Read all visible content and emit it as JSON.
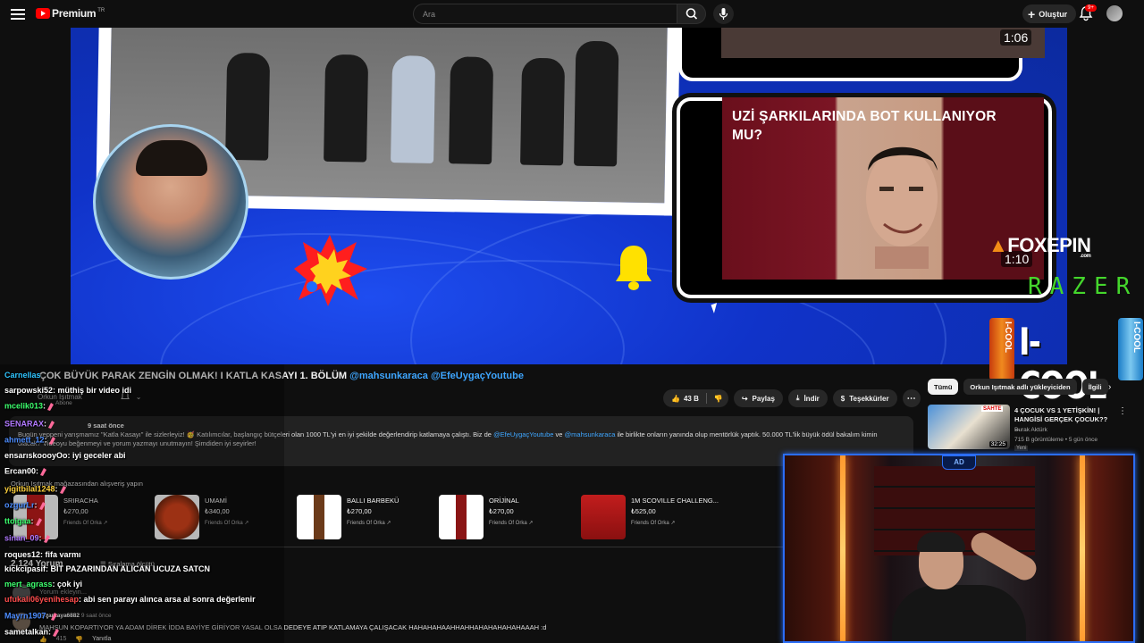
{
  "header": {
    "logo_text": "Premium",
    "logo_region": "TR",
    "search_placeholder": "Ara",
    "create_label": "Oluştur",
    "notifications_badge": "9+"
  },
  "player": {
    "card_title": "UZİ ŞARKILARINDA BOT KULLANIYOR MU?",
    "card_top_duration": "1:06",
    "card_main_duration": "1:10",
    "sponsors": [
      "FOXEPIN",
      ".com",
      "RAZER",
      "I-COOL"
    ]
  },
  "video": {
    "title": "ÇOK BÜYÜK PARAK ZENGİN OLMAK! I KATLA KASAYI 1. BÖLÜM",
    "title_mentions": "@mahsunkaraca @EfeUygaçYoutube",
    "channel": "Orkun Işıtmak",
    "subscribe_state": "Abone",
    "likes": "43 B",
    "share_label": "Paylaş",
    "download_label": "İndir",
    "thanks_label": "Teşekkürler",
    "desc_meta": "9 saat önce",
    "desc_line1_a": "Bugün yeppeni yarışmamız \"Katla Kasayı\" ile sizlerleyiz! 🥳 Katılımcılar, başlangıç bütçeleri olan 1000 TL'yi en iyi şekilde değerlendirip katlamaya çalıştı. Biz de",
    "desc_link1": "@EfeUygaçYoutube",
    "desc_ve": "ve",
    "desc_link2": "@mahsunkaraca",
    "desc_line1_b": "ile birlikte onların yanında olup mentörlük yaptık. 50.000 TL'lik büyük ödül bakalım kimin",
    "desc_line2": "olacak? Videoyu beğenmeyi ve yorum yazmayı unutmayın! Şimdiden iyi seyirler!"
  },
  "shop": {
    "heading": "Orkun Işıtmak mağazasından alışveriş yapın",
    "products": [
      {
        "name": "SRIRACHA",
        "price": "₺270,00",
        "seller": "Friends Of Orka ↗"
      },
      {
        "name": "UMAMİ",
        "price": "₺340,00",
        "seller": "Friends Of Orka ↗"
      },
      {
        "name": "BALLI BARBEKÜ",
        "price": "₺270,00",
        "seller": "Friends Of Orka ↗"
      },
      {
        "name": "ORİJİNAL",
        "price": "₺270,00",
        "seller": "Friends Of Orka ↗"
      },
      {
        "name": "1M SCOVILLE CHALLENG...",
        "price": "₺525,00",
        "seller": "Friends Of Orka ↗"
      }
    ]
  },
  "comments": {
    "count": "2.124 Yorum",
    "sort_label": "Sıralama ölçütü",
    "add_placeholder": "Yorum ekleyin...",
    "top_user": "@sarkaya6882",
    "top_time": "9 saat önce",
    "top_text": "MAHSUN KOPARTIYOR YA ADAM DİREK İDDA BAYİYE GİRİYOR YASAL OLSA DEDEYE ATIP KATLAMAYA ÇALIŞACAK HAHAHAHAAHHAHHAHAHAHAHAHAAAH :d",
    "top_likes": "415",
    "reply_label": "Yanıtla"
  },
  "chat": [
    {
      "user": "Carnellas",
      "text": "",
      "color": "#2fc5ff"
    },
    {
      "user": "sarpowski52",
      "text": ": müthiş bir video idi",
      "color": "#ffffff"
    },
    {
      "user": "mcelik013",
      "text": ":",
      "color": "#3dff6e"
    },
    {
      "user": "SENARAX",
      "text": ":",
      "color": "#b078ff"
    },
    {
      "user": "ahmett_12",
      "text": ":",
      "color": "#4d8dff"
    },
    {
      "user": "ensarıskoooyOo",
      "text": ": iyi geceler abi",
      "color": "#ffffff"
    },
    {
      "user": "Ercan00",
      "text": ":",
      "color": "#ffffff"
    },
    {
      "user": "yigitbilal1248",
      "text": ":",
      "color": "#ffd23e"
    },
    {
      "user": "ozgurLr",
      "text": ":",
      "color": "#4d8dff"
    },
    {
      "user": "ttoigaa",
      "text": ":",
      "color": "#3dff6e"
    },
    {
      "user": "sinan_09",
      "text": ":",
      "color": "#b078ff"
    },
    {
      "user": "roques12",
      "text": ": fifa varmı",
      "color": "#ffffff"
    },
    {
      "user": "kickcipasif",
      "text": ": BİT PAZARINDAN ALICAN UCUZA SATCN",
      "color": "#ffffff"
    },
    {
      "user": "mert_agrass",
      "text": ": çok iyi",
      "color": "#3dff6e"
    },
    {
      "user": "ufukali06yenihesap",
      "text": ": abi sen parayı alınca arsa al sonra değerlenir",
      "color": "#ff4d4d"
    },
    {
      "user": "Mayrn1907",
      "text": ":",
      "color": "#4d8dff"
    },
    {
      "user": "sametalkan",
      "text": ":",
      "color": "#ffffff"
    }
  ],
  "sidebar": {
    "chips": [
      "Tümü",
      "Orkun Işıtmak adlı yükleyiciden",
      "İlgili"
    ],
    "rec": {
      "title": "4 ÇOCUK VS 1 YETİŞKİN! | HANGİSİ GERÇEK ÇOCUK?? ...",
      "channel": "Burak Aktürk",
      "views": "715 B görüntüleme • 5 gün önce",
      "badge": "Yeni",
      "duration": "32:25",
      "thumb_sticker": "SAHTE"
    }
  },
  "webcam": {
    "badge": "AD"
  },
  "colors": {
    "accent_blue": "#3ea6ff",
    "brand_red": "#ff0000",
    "bg": "#0f0f0f"
  }
}
